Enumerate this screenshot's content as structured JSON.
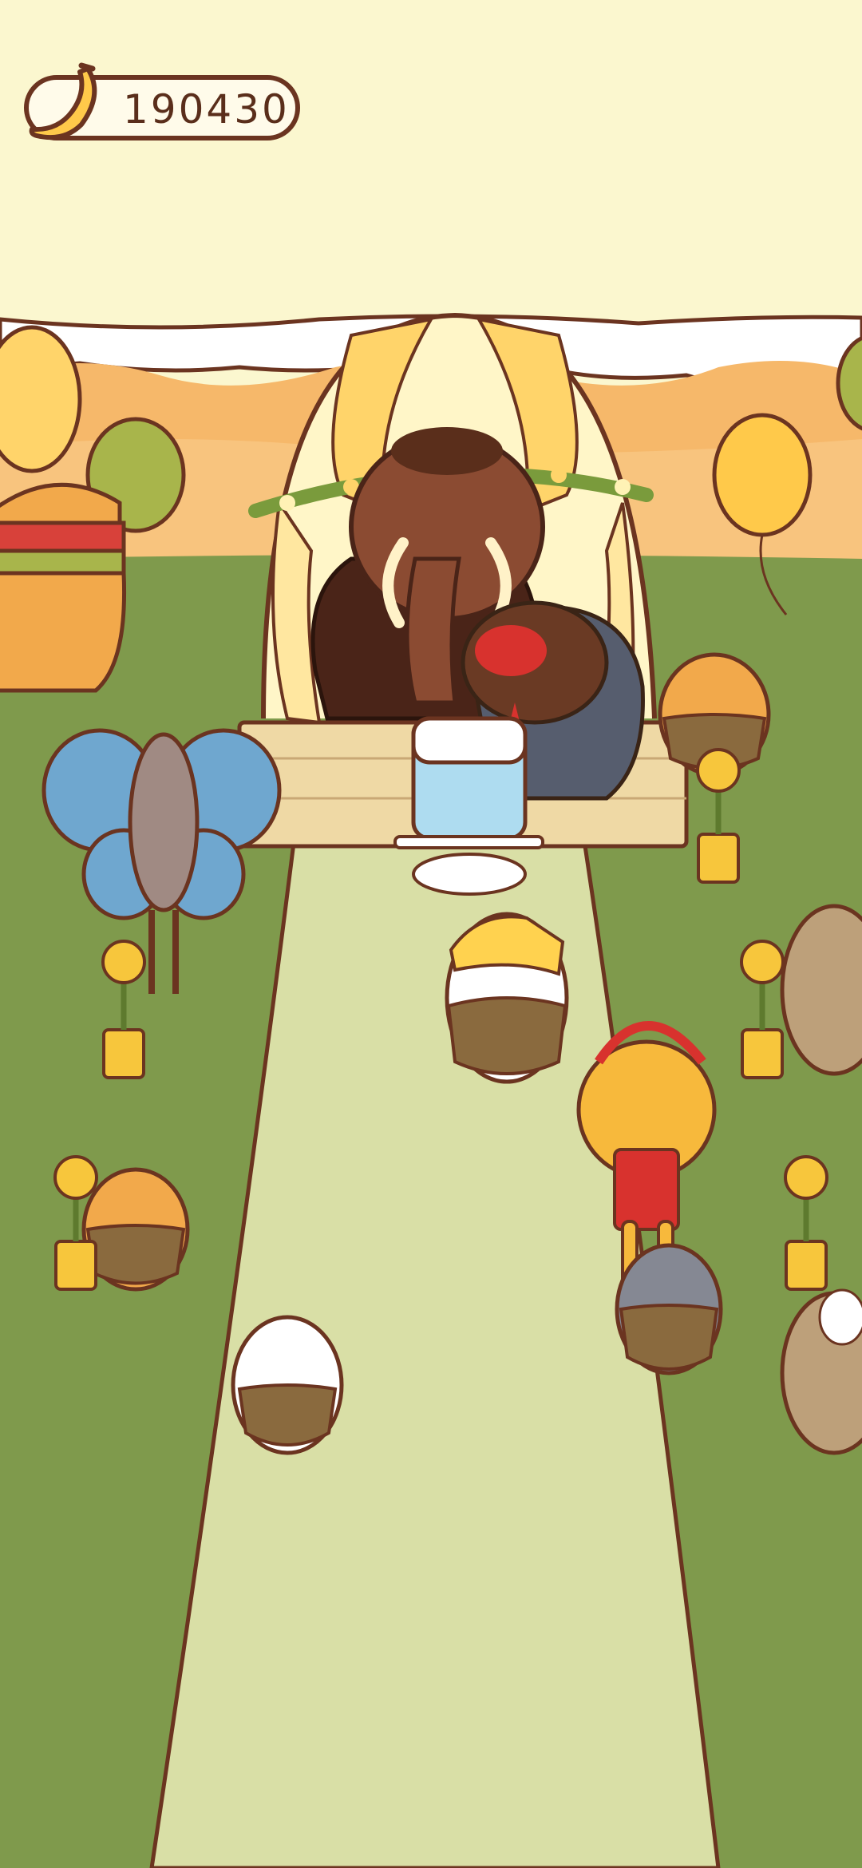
{
  "hud": {
    "banana_count": "190430",
    "currency_icon": "banana-icon"
  },
  "scene": {
    "name": "wedding-ceremony",
    "colors": {
      "sky": "#FBF7CF",
      "grass": "#7F9A4C",
      "aisle": "#D9DFA6",
      "outline": "#6B3420",
      "hills": "#F6B86A"
    },
    "characters": [
      {
        "name": "mammoth-groom",
        "role": "groom"
      },
      {
        "name": "gorilla-bride",
        "role": "bride"
      },
      {
        "name": "cake-officiant",
        "role": "officiant"
      },
      {
        "name": "calico-cat-guest"
      },
      {
        "name": "tiger-cat-with-headphones"
      },
      {
        "name": "gray-cat-guest"
      },
      {
        "name": "orange-tabby-cat-guest"
      },
      {
        "name": "white-cat-guest"
      },
      {
        "name": "butterfly-statue"
      },
      {
        "name": "burger-balloon"
      }
    ]
  }
}
